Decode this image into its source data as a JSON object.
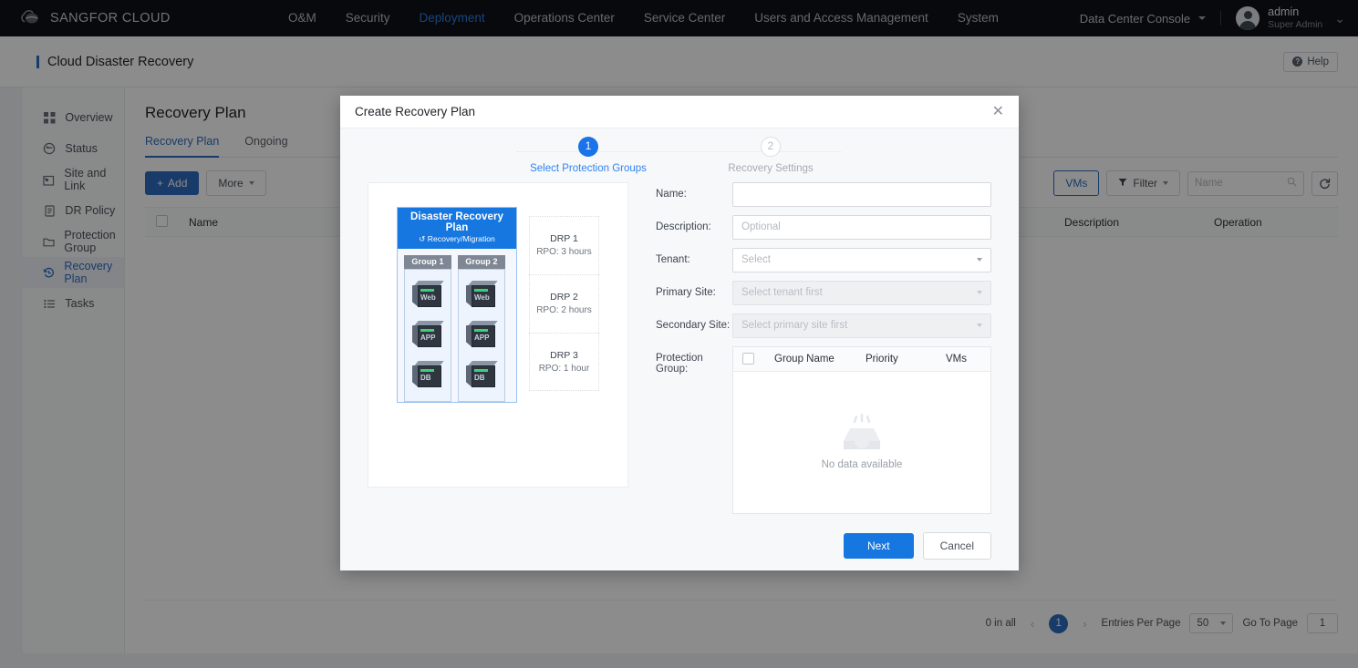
{
  "topnav": {
    "brand": "SANGFOR CLOUD",
    "brand_icon": "cloud-logo-icon",
    "items": [
      {
        "label": "O&M",
        "active": false
      },
      {
        "label": "Security",
        "active": false
      },
      {
        "label": "Deployment",
        "active": true
      },
      {
        "label": "Operations Center",
        "active": false
      },
      {
        "label": "Service Center",
        "active": false
      },
      {
        "label": "Users and Access Management",
        "active": false
      },
      {
        "label": "System",
        "active": false
      }
    ],
    "console_selector": "Data Center Console",
    "user": {
      "name": "admin",
      "role": "Super Admin"
    },
    "accent": "#2f7ee0"
  },
  "pagebar": {
    "title": "Cloud Disaster Recovery",
    "help_label": "Help"
  },
  "sidebar": {
    "items": [
      {
        "label": "Overview",
        "icon": "grid-icon",
        "active": false
      },
      {
        "label": "Status",
        "icon": "status-circle-icon",
        "active": false
      },
      {
        "label": "Site and Link",
        "icon": "building-icon",
        "active": false
      },
      {
        "label": "DR Policy",
        "icon": "document-icon",
        "active": false
      },
      {
        "label": "Protection Group",
        "icon": "folder-icon",
        "active": false
      },
      {
        "label": "Recovery Plan",
        "icon": "history-clock-icon",
        "active": true
      },
      {
        "label": "Tasks",
        "icon": "list-icon",
        "active": false
      }
    ]
  },
  "main": {
    "title": "Recovery Plan",
    "tabs": [
      {
        "label": "Recovery Plan",
        "active": true
      },
      {
        "label": "Ongoing",
        "active": false
      }
    ],
    "toolbar": {
      "add_label": "Add",
      "more_label": "More",
      "vms_label": "VMs",
      "filter_label": "Filter",
      "search_placeholder": "Name",
      "search_value": "",
      "refresh_icon": "refresh-icon"
    },
    "table": {
      "columns": [
        "",
        "Name",
        "",
        "",
        "Description",
        "Operation"
      ],
      "rows": []
    },
    "pagination": {
      "total_label": "0 in all",
      "prev_icon": "chevron-left-icon",
      "next_icon": "chevron-right-icon",
      "current_page": "1",
      "entries_label": "Entries Per Page",
      "entries_value": "50",
      "goto_label": "Go To Page",
      "goto_value": "1"
    }
  },
  "modal": {
    "title": "Create Recovery Plan",
    "close_icon": "close-icon",
    "steps": [
      {
        "num": "1",
        "label": "Select Protection Groups",
        "state": "done"
      },
      {
        "num": "2",
        "label": "Recovery Settings",
        "state": "todo"
      }
    ],
    "illustration": {
      "plan_title": "Disaster Recovery Plan",
      "plan_subtitle": "Recovery/Migration",
      "plan_subtitle_icon": "sync-dotted-icon",
      "groups": [
        {
          "name": "Group 1",
          "vms": [
            "Web",
            "APP",
            "DB"
          ]
        },
        {
          "name": "Group 2",
          "vms": [
            "Web",
            "APP",
            "DB"
          ]
        }
      ],
      "drps": [
        {
          "name": "DRP 1",
          "rpo": "RPO: 3 hours"
        },
        {
          "name": "DRP 2",
          "rpo": "RPO: 2 hours"
        },
        {
          "name": "DRP 3",
          "rpo": "RPO: 1 hour"
        }
      ]
    },
    "form": {
      "name": {
        "label": "Name:",
        "value": "",
        "placeholder": ""
      },
      "description": {
        "label": "Description:",
        "value": "",
        "placeholder": "Optional"
      },
      "tenant": {
        "label": "Tenant:",
        "value": "Select",
        "disabled": false
      },
      "primary_site": {
        "label": "Primary Site:",
        "value": "Select tenant first",
        "disabled": true
      },
      "secondary_site": {
        "label": "Secondary Site:",
        "value": "Select primary site first",
        "disabled": true
      },
      "protection_group": {
        "label": "Protection Group:",
        "columns": [
          "Group Name",
          "Priority",
          "VMs"
        ],
        "rows": [],
        "empty_text": "No data available",
        "empty_icon": "empty-inbox-icon"
      }
    },
    "footer": {
      "next_label": "Next",
      "cancel_label": "Cancel"
    },
    "accent": "#1677e0"
  }
}
